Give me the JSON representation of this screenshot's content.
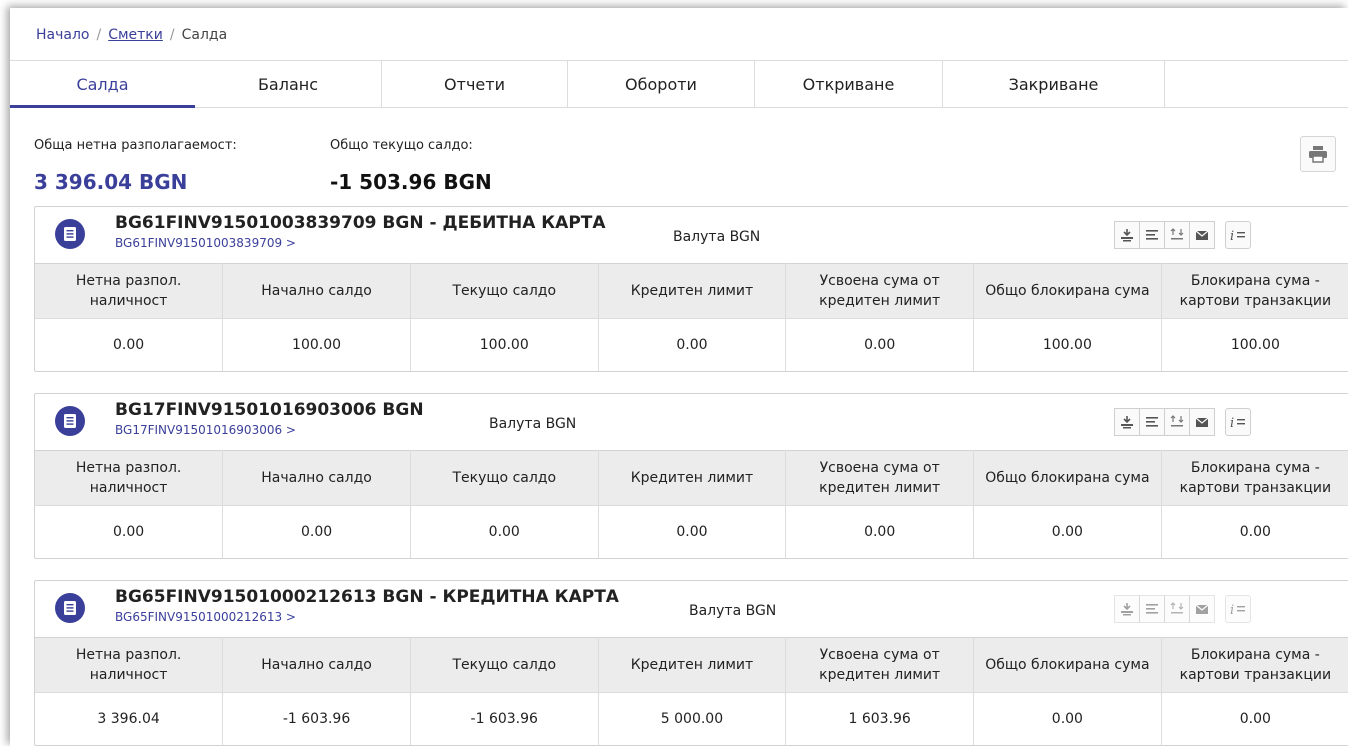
{
  "breadcrumb": {
    "home": "Начало",
    "accounts": "Сметки",
    "current": "Салда",
    "sep": "/"
  },
  "tabs": [
    "Салда",
    "Баланс",
    "Отчети",
    "Обороти",
    "Откриване",
    "Закриване"
  ],
  "summary": {
    "net_label": "Обща нетна разполагаемост:",
    "net_value": "3 396.04 BGN",
    "balance_label": "Общо текущо салдо:",
    "balance_value": "-1 503.96 BGN"
  },
  "columns": [
    "Нетна разпол. наличност",
    "Начално салдо",
    "Текущо салдо",
    "Кредитен лимит",
    "Усвоена сума от кредитен лимит",
    "Общо блокирана сума",
    "Блокирана сума - картови транзакции"
  ],
  "accounts": [
    {
      "title": "BG61FINV91501003839709 BGN - ДЕБИТНА КАРТА",
      "iban": "BG61FINV91501003839709 >",
      "currency": "Валута BGN",
      "values": [
        "0.00",
        "100.00",
        "100.00",
        "0.00",
        "0.00",
        "100.00",
        "100.00"
      ]
    },
    {
      "title": "BG17FINV91501016903006 BGN",
      "iban": "BG17FINV91501016903006 >",
      "currency": "Валута BGN",
      "values": [
        "0.00",
        "0.00",
        "0.00",
        "0.00",
        "0.00",
        "0.00",
        "0.00"
      ]
    },
    {
      "title": "BG65FINV91501000212613 BGN - КРЕДИТНА КАРТА",
      "iban": "BG65FINV91501000212613 >",
      "currency": "Валута BGN",
      "values": [
        "3 396.04",
        "-1 603.96",
        "-1 603.96",
        "5 000.00",
        "1 603.96",
        "0.00",
        "0.00"
      ]
    }
  ],
  "colors": {
    "accent": "#3a3f9a",
    "header_bg": "#ececec"
  },
  "icons": {
    "print": "printer-icon",
    "account": "document-icon",
    "tools": [
      "transfer-icon",
      "statement-lines-icon",
      "turnover-icon",
      "mail-icon",
      "info-list-icon"
    ]
  }
}
